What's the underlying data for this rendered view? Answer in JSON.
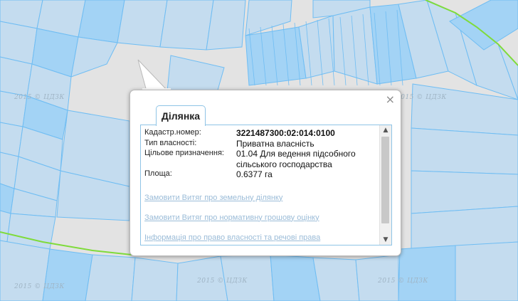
{
  "popup": {
    "tab_label": "Ділянка",
    "close_symbol": "×",
    "fields": [
      {
        "label": "Кадастр.номер:",
        "value": "3221487300:02:014:0100",
        "bold": true
      },
      {
        "label": "Тип власності:",
        "value": "Приватна власність",
        "bold": false
      },
      {
        "label": "Цільове призначення:",
        "value": "01.04 Для ведення підсобного сільського господарства",
        "bold": false
      },
      {
        "label": "Площа:",
        "value": "0.6377 га",
        "bold": false
      }
    ],
    "links": [
      "Замовити Витяг про земельну ділянку",
      "Замовити Витяг про нормативну грошову оцінку",
      "Інформація про право власності та речові права"
    ]
  },
  "map": {
    "watermark": "2015 © ЦДЗК",
    "parcel_fill": "#c4dcef",
    "parcel_alt_fill": "#a3d3f5",
    "parcel_stroke": "#6fbdf3",
    "background": "#e3e3e3",
    "road_color": "#7fdb3a"
  },
  "icons": {
    "close": "close-icon",
    "scroll_up": "arrow-up-icon",
    "scroll_down": "arrow-down-icon"
  }
}
